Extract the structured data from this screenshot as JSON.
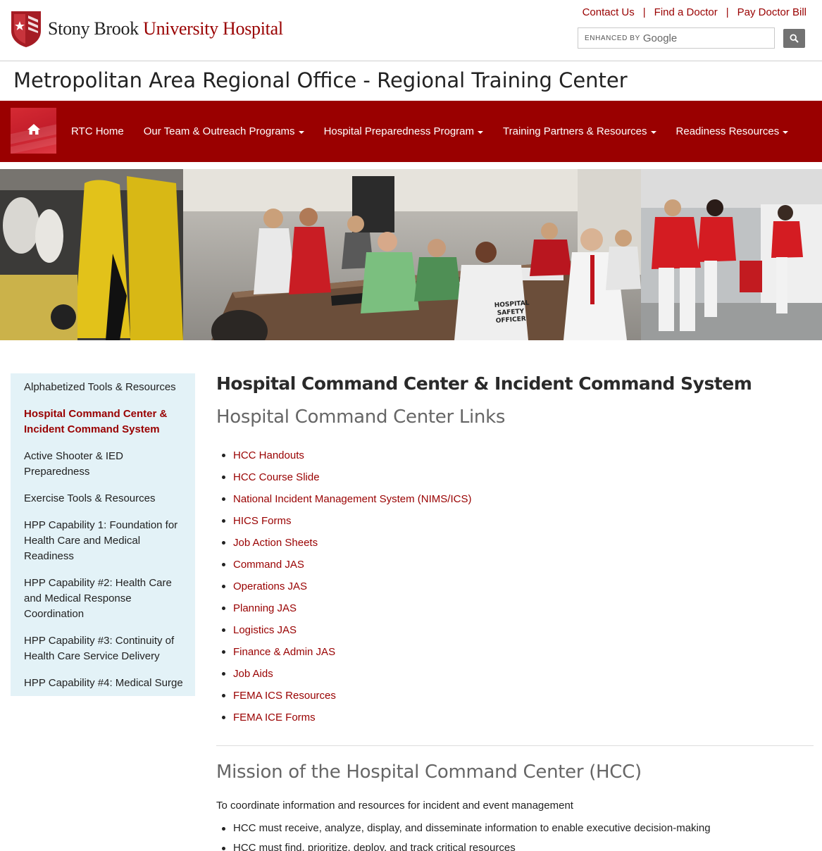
{
  "header": {
    "logo_part1": "Stony Brook ",
    "logo_part2": "University Hospital",
    "toplinks": [
      "Contact Us",
      "Find a Doctor",
      "Pay Doctor Bill"
    ],
    "search_enhanced": "ENHANCED BY",
    "search_google": "Google"
  },
  "site_title": "Metropolitan Area Regional Office - Regional Training Center",
  "nav": {
    "items": [
      {
        "label": "RTC Home",
        "dropdown": false
      },
      {
        "label": "Our Team & Outreach Programs",
        "dropdown": true
      },
      {
        "label": "Hospital Preparedness Program",
        "dropdown": true
      },
      {
        "label": "Training Partners & Resources",
        "dropdown": true
      },
      {
        "label": "Readiness Resources",
        "dropdown": true
      }
    ]
  },
  "banner": {
    "sign_hospital": "HOSPITAL",
    "sign_safety": "SAFETY",
    "sign_officer": "OFFICER"
  },
  "sidebar": {
    "items": [
      "Alphabetized Tools & Resources",
      "Hospital Command Center & Incident Command System",
      "Active Shooter & IED Preparedness",
      "Exercise Tools & Resources",
      "HPP Capability 1: Foundation for Health Care and Medical Readiness",
      "HPP Capability #2: Health Care and Medical Response Coordination",
      "HPP Capability #3: Continuity of Health Care Service Delivery",
      "HPP Capability #4: Medical Surge"
    ],
    "active_index": 1
  },
  "main": {
    "title": "Hospital Command Center & Incident Command System",
    "links_heading": "Hospital Command Center Links",
    "links": [
      "HCC Handouts",
      "HCC Course Slide",
      "National Incident Management System (NIMS/ICS)",
      "HICS Forms",
      "Job Action Sheets",
      "Command JAS",
      "Operations JAS",
      "Planning JAS",
      "Logistics JAS",
      "Finance & Admin JAS",
      "Job Aids",
      "FEMA ICS Resources",
      "FEMA ICE Forms"
    ],
    "mission_heading": "Mission of the Hospital Command Center (HCC)",
    "mission_text": "To coordinate information and resources for incident and event management",
    "mission_bullets": [
      "HCC must receive, analyze, display, and disseminate information to enable executive decision-making",
      "HCC must find, prioritize, deploy, and track critical resources"
    ]
  },
  "colors": {
    "brand_red": "#990000",
    "nav_red": "#9a0000",
    "sidebar_bg": "#e3f2f7"
  }
}
